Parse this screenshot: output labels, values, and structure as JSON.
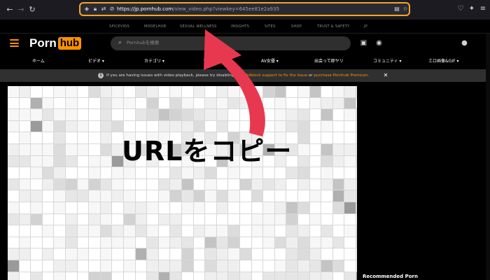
{
  "browser": {
    "url_host": "https://jp.pornhub.com",
    "url_path": "/view_video.php?viewkey=645ee81e2a935",
    "nav_icons": [
      "back-icon",
      "forward-icon",
      "reload-icon"
    ],
    "address_icons": [
      "shield-icon",
      "lock-icon",
      "permissions-icon",
      "camera-blocked-icon"
    ],
    "right_icons": [
      "reader-view-icon",
      "bookmark-star-icon",
      "pocket-icon",
      "extensions-icon",
      "menu-icon"
    ],
    "highlight_color": "#f6a623"
  },
  "network_bar": {
    "items": [
      "SPICEVIDS",
      "MODELHUB",
      "SEXUAL WELLNESS",
      "INSIGHTS",
      "SITES",
      "SHOP",
      "TRUST & SAFETY",
      "JP"
    ]
  },
  "header": {
    "logo_left": "Porn",
    "logo_right": "hub",
    "search_placeholder": "Pornhubを検索",
    "brand_color": "#ff9000",
    "icons": [
      "upload-icon",
      "camera-icon",
      "account-icon"
    ]
  },
  "category_nav": {
    "items": [
      "ホーム",
      "ビデオ ▾",
      "カテゴリ ▾",
      "ライブカ",
      "AV女優 ▾",
      "出会って即ヤリ",
      "コミュニティ ▾",
      "エロ画像&GIF ▾"
    ]
  },
  "notice": {
    "text_before": "If you are having issues with video playback, please try disabling Ad",
    "text_link1": "ct Adblock support to fix the issue",
    "text_mid": " or ",
    "text_link2": "purchase Pornhub Premium.",
    "close": "✕"
  },
  "sidebar": {
    "recommended_label": "Recommended Porn"
  },
  "annotation": {
    "text": "URLをコピー",
    "arrow_color": "#e8384f"
  }
}
